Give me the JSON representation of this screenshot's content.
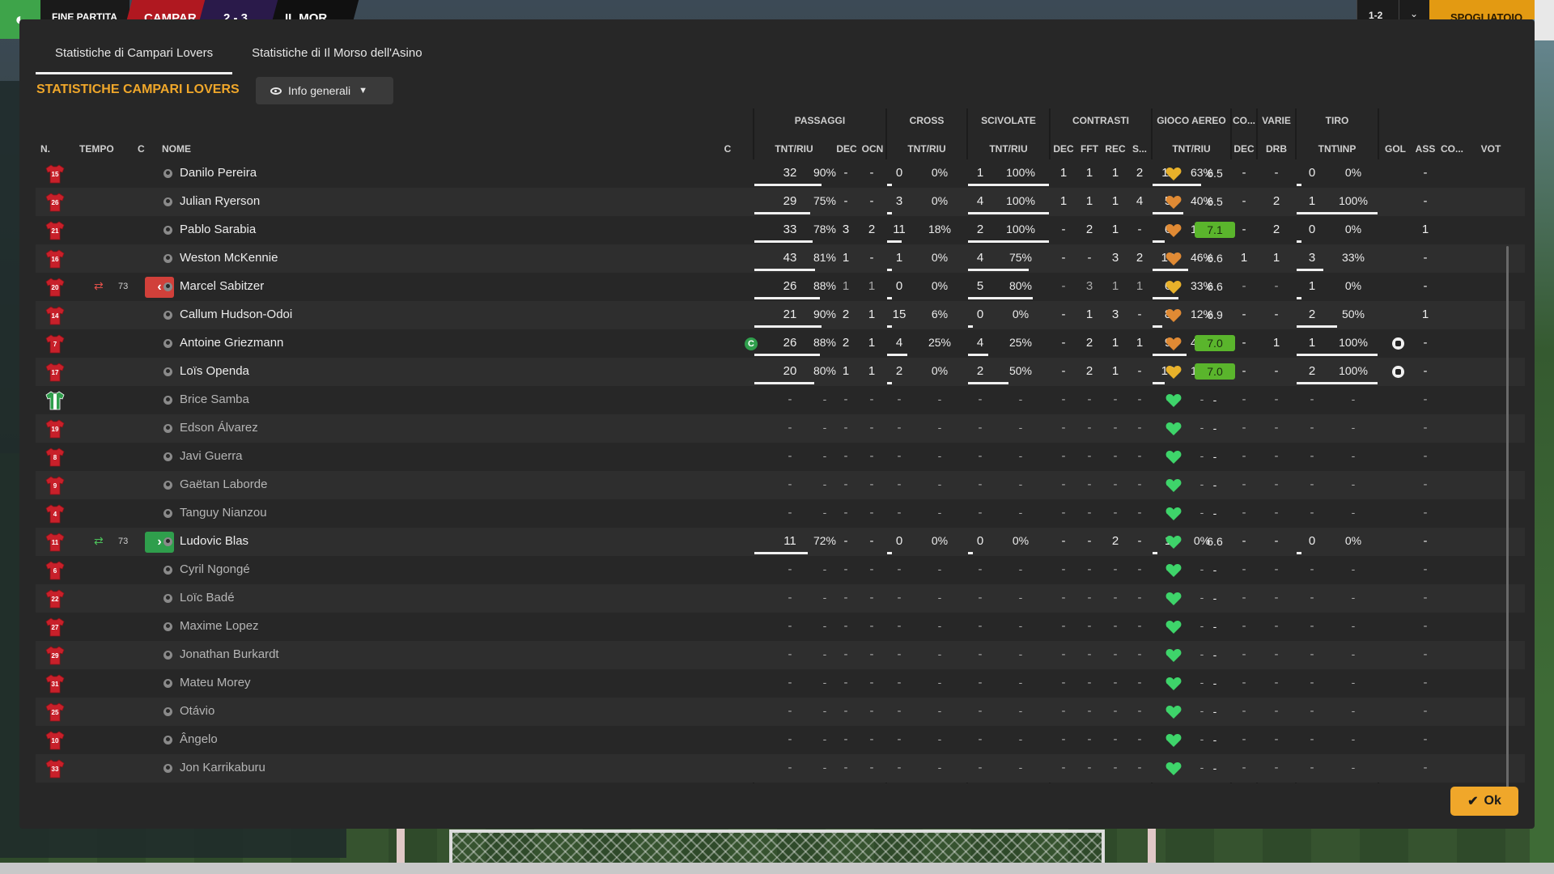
{
  "topbar": {
    "status": "FINE PARTITA",
    "home": "CAMPAR",
    "score": "2 - 3",
    "away": "IL MOR",
    "scoreline": "1-2",
    "exit": "SPOGLIATOIO"
  },
  "tabs": [
    {
      "label": "Statistiche di Campari Lovers",
      "active": true
    },
    {
      "label": "Statistiche di Il Morso dell'Asino",
      "active": false
    }
  ],
  "section_title": "STATISTICHE CAMPARI LOVERS",
  "view_dropdown": {
    "selected": "Info generali",
    "icon": "eye-icon"
  },
  "groups": {
    "passaggi": "PASSAGGI",
    "cross": "CROSS",
    "scivolate": "SCIVOLATE",
    "contrasti": "CONTRASTI",
    "gioco_aereo": "GIOCO AEREO",
    "co": "CO...",
    "varie": "VARIE",
    "tiro": "TIRO"
  },
  "columns": {
    "n": "N.",
    "tempo": "TEMPO",
    "c": "C",
    "nome": "NOME",
    "capt": "C",
    "pass_tr": "TNT/RIU",
    "pass_dec": "DEC",
    "pass_ocn": "OCN",
    "cross_tr": "TNT/RIU",
    "sciv_tr": "TNT/RIU",
    "con_dec": "DEC",
    "con_fft": "FFT",
    "con_rec": "REC",
    "con_s": "S...",
    "aer_tr": "TNT/RIU",
    "co_dec": "DEC",
    "var_drb": "DRB",
    "tiro_ti": "TNT\\INP",
    "gol": "GOL",
    "ass": "ASS",
    "cond": "CO...",
    "vot": "VOT"
  },
  "players": [
    {
      "num": "15",
      "name": "Danilo Pereira",
      "pt": "32",
      "pp": "90%",
      "pdec": "-",
      "pocn": "-",
      "ct": "0",
      "cp": "0%",
      "st": "1",
      "sp": "100%",
      "cdec": "1",
      "cfft": "1",
      "crec": "1",
      "cs": "2",
      "at": "11",
      "ap": "63%",
      "codec": "-",
      "drb": "-",
      "tt": "0",
      "tp": "0%",
      "gol": "",
      "ass": "-",
      "vot": "6.5",
      "cond": "gold"
    },
    {
      "num": "26",
      "name": "Julian Ryerson",
      "pt": "29",
      "pp": "75%",
      "pdec": "-",
      "pocn": "-",
      "ct": "3",
      "cp": "0%",
      "st": "4",
      "sp": "100%",
      "cdec": "1",
      "cfft": "1",
      "crec": "1",
      "cs": "4",
      "at": "5",
      "ap": "40%",
      "codec": "-",
      "drb": "2",
      "tt": "1",
      "tp": "100%",
      "gol": "",
      "ass": "-",
      "vot": "6.5",
      "cond": "orange"
    },
    {
      "num": "21",
      "name": "Pablo Sarabia",
      "pt": "33",
      "pp": "78%",
      "pdec": "3",
      "pocn": "2",
      "ct": "11",
      "cp": "18%",
      "st": "2",
      "sp": "100%",
      "cdec": "-",
      "cfft": "2",
      "crec": "1",
      "cs": "-",
      "at": "6",
      "ap": "16%",
      "codec": "-",
      "drb": "2",
      "tt": "0",
      "tp": "0%",
      "gol": "",
      "ass": "1",
      "vot": "7.1",
      "cond": "orange"
    },
    {
      "num": "16",
      "name": "Weston McKennie",
      "pt": "43",
      "pp": "81%",
      "pdec": "1",
      "pocn": "-",
      "ct": "1",
      "cp": "0%",
      "st": "4",
      "sp": "75%",
      "cdec": "-",
      "cfft": "-",
      "crec": "3",
      "cs": "2",
      "at": "13",
      "ap": "46%",
      "codec": "1",
      "drb": "1",
      "tt": "3",
      "tp": "33%",
      "gol": "",
      "ass": "-",
      "vot": "6.6",
      "cond": "orange"
    },
    {
      "num": "20",
      "name": "Marcel Sabitzer",
      "pt": "26",
      "pp": "88%",
      "pdec": "1",
      "pocn": "1",
      "ct": "0",
      "cp": "0%",
      "st": "5",
      "sp": "80%",
      "cdec": "-",
      "cfft": "3",
      "crec": "1",
      "cs": "1",
      "at": "6",
      "ap": "33%",
      "codec": "-",
      "drb": "-",
      "tt": "1",
      "tp": "0%",
      "gol": "",
      "ass": "-",
      "vot": "6.6",
      "cond": "gold",
      "sub": "out",
      "subtime": "73"
    },
    {
      "num": "14",
      "name": "Callum Hudson-Odoi",
      "pt": "21",
      "pp": "90%",
      "pdec": "2",
      "pocn": "1",
      "ct": "15",
      "cp": "6%",
      "st": "0",
      "sp": "0%",
      "cdec": "-",
      "cfft": "1",
      "crec": "3",
      "cs": "-",
      "at": "8",
      "ap": "12%",
      "codec": "-",
      "drb": "-",
      "tt": "2",
      "tp": "50%",
      "gol": "",
      "ass": "1",
      "vot": "6.9",
      "cond": "orange"
    },
    {
      "num": "7",
      "name": "Antoine Griezmann",
      "pt": "26",
      "pp": "88%",
      "pdec": "2",
      "pocn": "1",
      "ct": "4",
      "cp": "25%",
      "st": "4",
      "sp": "25%",
      "cdec": "-",
      "cfft": "2",
      "crec": "1",
      "cs": "1",
      "at": "9",
      "ap": "44%",
      "codec": "-",
      "drb": "1",
      "tt": "1",
      "tp": "100%",
      "gol": "ball",
      "ass": "-",
      "vot": "7.0",
      "cond": "orange",
      "captain": "C"
    },
    {
      "num": "17",
      "name": "Loïs Openda",
      "pt": "20",
      "pp": "80%",
      "pdec": "1",
      "pocn": "1",
      "ct": "2",
      "cp": "0%",
      "st": "2",
      "sp": "50%",
      "cdec": "-",
      "cfft": "2",
      "crec": "1",
      "cs": "-",
      "at": "18",
      "ap": "16%",
      "codec": "-",
      "drb": "-",
      "tt": "2",
      "tp": "100%",
      "gol": "ball",
      "ass": "-",
      "vot": "7.0",
      "cond": "gold"
    },
    {
      "num": "",
      "name": "Brice Samba",
      "gk": true,
      "bench": true,
      "cond": "green"
    },
    {
      "num": "19",
      "name": "Edson Álvarez",
      "bench": true,
      "cond": "green"
    },
    {
      "num": "8",
      "name": "Javi Guerra",
      "bench": true,
      "cond": "green"
    },
    {
      "num": "9",
      "name": "Gaëtan Laborde",
      "bench": true,
      "cond": "green"
    },
    {
      "num": "4",
      "name": "Tanguy Nianzou",
      "bench": true,
      "cond": "green"
    },
    {
      "num": "11",
      "name": "Ludovic Blas",
      "pt": "11",
      "pp": "72%",
      "pdec": "-",
      "pocn": "-",
      "ct": "0",
      "cp": "0%",
      "st": "0",
      "sp": "0%",
      "cdec": "-",
      "cfft": "-",
      "crec": "2",
      "cs": "-",
      "at": "1",
      "ap": "0%",
      "codec": "-",
      "drb": "-",
      "tt": "0",
      "tp": "0%",
      "gol": "",
      "ass": "-",
      "vot": "6.6",
      "cond": "green",
      "sub": "in",
      "subtime": "73"
    },
    {
      "num": "6",
      "name": "Cyril Ngongé",
      "bench": true,
      "cond": "green"
    },
    {
      "num": "22",
      "name": "Loïc Badé",
      "bench": true,
      "cond": "green"
    },
    {
      "num": "27",
      "name": "Maxime Lopez",
      "bench": true,
      "cond": "green"
    },
    {
      "num": "29",
      "name": "Jonathan Burkardt",
      "bench": true,
      "cond": "green"
    },
    {
      "num": "31",
      "name": "Mateu Morey",
      "bench": true,
      "cond": "green"
    },
    {
      "num": "25",
      "name": "Otávio",
      "bench": true,
      "cond": "green"
    },
    {
      "num": "10",
      "name": "Ângelo",
      "bench": true,
      "cond": "green"
    },
    {
      "num": "33",
      "name": "Jon Karrikaburu",
      "bench": true,
      "cond": "green"
    }
  ],
  "ok_button": "Ok",
  "colors": {
    "accent": "#f0a72a",
    "good_rating": "#5ab52c",
    "sub_out": "#d1403a",
    "sub_in": "#2f9e4c",
    "shirt": "#c8202a"
  }
}
